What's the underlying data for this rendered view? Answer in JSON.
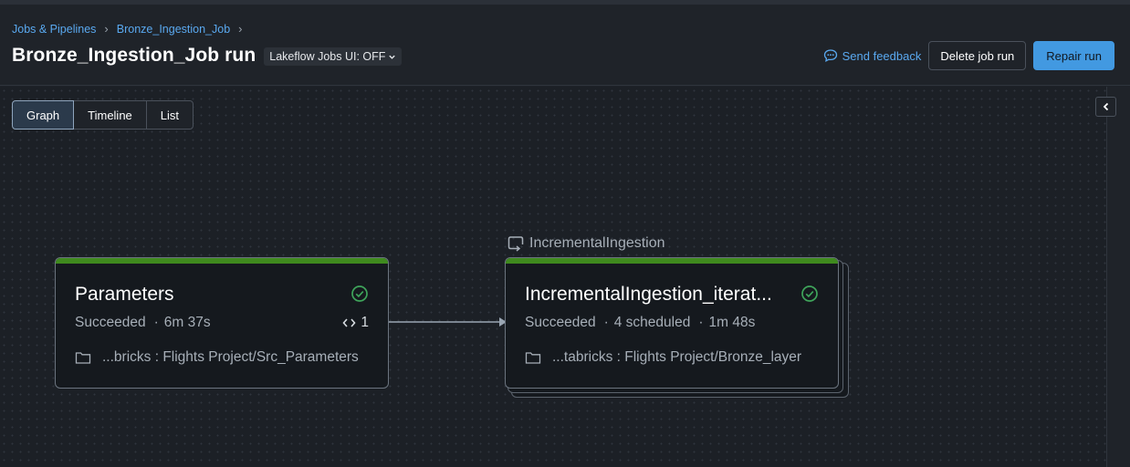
{
  "breadcrumb": {
    "items": [
      "Jobs & Pipelines",
      "Bronze_Ingestion_Job"
    ],
    "separator": "›"
  },
  "header": {
    "title": "Bronze_Ingestion_Job run",
    "ui_toggle": "Lakeflow Jobs UI: OFF",
    "feedback_label": "Send feedback",
    "delete_label": "Delete job run",
    "repair_label": "Repair run"
  },
  "view_tabs": [
    {
      "label": "Graph",
      "active": true
    },
    {
      "label": "Timeline",
      "active": false
    },
    {
      "label": "List",
      "active": false
    }
  ],
  "nodes": {
    "parameters": {
      "title": "Parameters",
      "status": "Succeeded",
      "duration": "6m 37s",
      "code_count": "1",
      "path": "...bricks : Flights Project/Src_Parameters"
    },
    "incremental": {
      "group_label": "IncrementalIngestion",
      "title": "IncrementalIngestion_iterat...",
      "status": "Succeeded",
      "scheduled": "4 scheduled",
      "duration": "1m 48s",
      "path": "...tabricks : Flights Project/Bronze_layer"
    }
  },
  "colors": {
    "accent": "#4299e1",
    "link": "#5aa9f0",
    "success": "#3f8a1e",
    "success_icon": "#3fa55b"
  },
  "icons": {
    "feedback": "speech-bubble-icon",
    "status": "check-circle-icon",
    "code": "code-brackets-icon",
    "folder": "folder-icon",
    "loop": "loop-icon",
    "collapse": "chevron-left-icon"
  }
}
